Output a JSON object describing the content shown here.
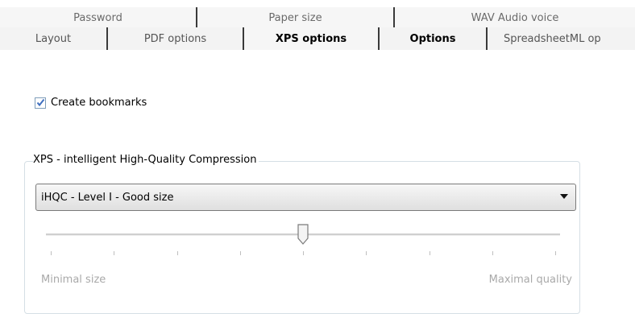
{
  "tabs": {
    "back_row": [
      {
        "label": "Password"
      },
      {
        "label": "Paper size"
      },
      {
        "label": "WAV Audio voice"
      }
    ],
    "front_row": [
      {
        "label": "Layout"
      },
      {
        "label": "PDF options"
      },
      {
        "label": "XPS options",
        "selected": true
      },
      {
        "label": "Options"
      },
      {
        "label": "SpreadsheetML op"
      }
    ]
  },
  "checkbox": {
    "label": "Create bookmarks",
    "checked": true
  },
  "group": {
    "title": "XPS - intelligent High-Quality Compression",
    "dropdown_value": "iHQC - Level I - Good size",
    "slider": {
      "value_fraction": 0.5,
      "tick_count": 9,
      "min_label": "Minimal size",
      "max_label": "Maximal quality"
    }
  },
  "colors": {
    "checkmark": "#3f6fbf",
    "group_border": "#d5dfe5"
  }
}
